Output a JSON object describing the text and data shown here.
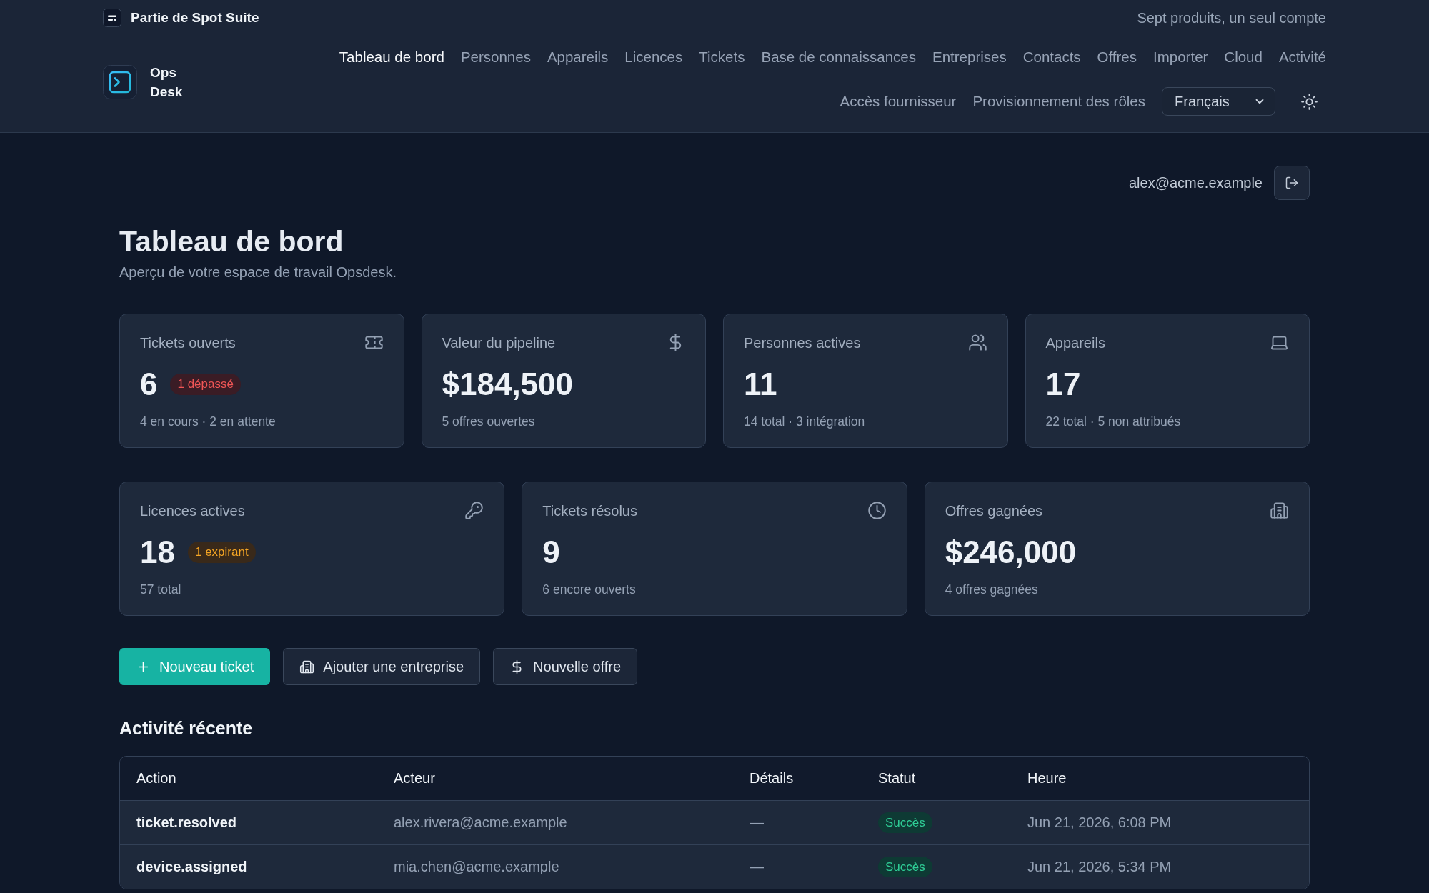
{
  "suite_bar": {
    "brand": "Partie de Spot Suite",
    "tagline": "Sept produits, un seul compte"
  },
  "header": {
    "app_name": "Ops Desk",
    "nav": [
      {
        "label": "Tableau de bord",
        "selected": true
      },
      {
        "label": "Personnes",
        "selected": false
      },
      {
        "label": "Appareils",
        "selected": false
      },
      {
        "label": "Licences",
        "selected": false
      },
      {
        "label": "Tickets",
        "selected": false
      },
      {
        "label": "Base de connaissances",
        "selected": false
      },
      {
        "label": "Entreprises",
        "selected": false
      },
      {
        "label": "Contacts",
        "selected": false
      },
      {
        "label": "Offres",
        "selected": false
      },
      {
        "label": "Importer",
        "selected": false
      },
      {
        "label": "Cloud",
        "selected": false
      },
      {
        "label": "Activité",
        "selected": false
      },
      {
        "label": "Accès fournisseur",
        "selected": false
      },
      {
        "label": "Provisionnement des rôles",
        "selected": false
      }
    ],
    "language": "Français"
  },
  "user": {
    "email": "alex@acme.example"
  },
  "page": {
    "title": "Tableau de bord",
    "subtitle": "Aperçu de votre espace de travail Opsdesk."
  },
  "stats_primary": [
    {
      "label": "Tickets ouverts",
      "value": "6",
      "badge": {
        "text": "1 dépassé",
        "kind": "danger"
      },
      "note": "4 en cours · 2 en attente"
    },
    {
      "label": "Valeur du pipeline",
      "value": "$184,500",
      "note": "5 offres ouvertes"
    },
    {
      "label": "Personnes actives",
      "value": "11",
      "note": "14 total · 3 intégration"
    },
    {
      "label": "Appareils",
      "value": "17",
      "note": "22 total · 5 non attribués"
    }
  ],
  "stats_secondary": [
    {
      "label": "Licences actives",
      "value": "18",
      "badge": {
        "text": "1 expirant",
        "kind": "warning"
      },
      "note": "57 total"
    },
    {
      "label": "Tickets résolus",
      "value": "9",
      "note": "6 encore ouverts"
    },
    {
      "label": "Offres gagnées",
      "value": "$246,000",
      "note": "4 offres gagnées"
    }
  ],
  "actions": [
    {
      "label": "Nouveau ticket",
      "kind": "primary"
    },
    {
      "label": "Ajouter une entreprise",
      "kind": "secondary"
    },
    {
      "label": "Nouvelle offre",
      "kind": "secondary"
    }
  ],
  "activity": {
    "title": "Activité récente",
    "columns": [
      "Action",
      "Acteur",
      "Détails",
      "Statut",
      "Heure"
    ],
    "rows": [
      {
        "action": "ticket.resolved",
        "actor": "alex.rivera@acme.example",
        "details": "—",
        "status": {
          "label": "Succès",
          "kind": "success"
        },
        "time": "Jun 21, 2026, 6:08 PM"
      },
      {
        "action": "device.assigned",
        "actor": "mia.chen@acme.example",
        "details": "—",
        "status": {
          "label": "Succès",
          "kind": "success"
        },
        "time": "Jun 21, 2026, 5:34 PM"
      }
    ]
  }
}
